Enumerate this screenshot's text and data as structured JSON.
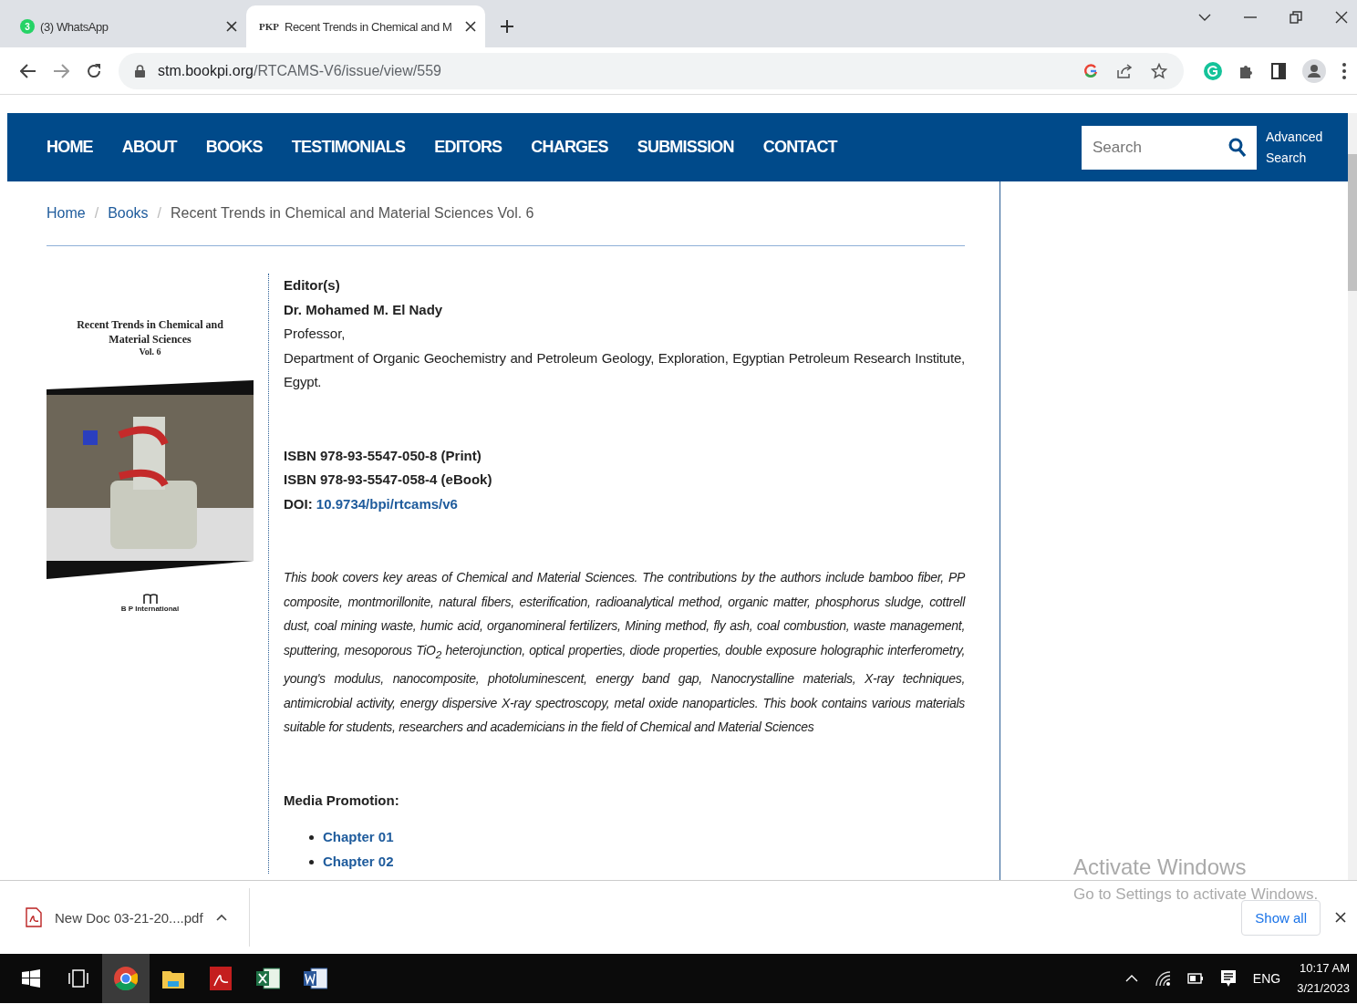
{
  "browser": {
    "tabs": [
      {
        "kind": "whatsapp",
        "badge": "3",
        "title": "(3) WhatsApp",
        "selected": false
      },
      {
        "kind": "pkp",
        "badge": "PKP",
        "title": "Recent Trends in Chemical and M",
        "selected": true
      }
    ],
    "address": {
      "domain": "stm.bookpi.org",
      "path": "/RTCAMS-V6/issue/view/559"
    }
  },
  "nav": {
    "items": [
      "HOME",
      "ABOUT",
      "BOOKS",
      "TESTIMONIALS",
      "EDITORS",
      "CHARGES",
      "SUBMISSION",
      "CONTACT"
    ],
    "search": {
      "placeholder": "Search"
    },
    "advanced_search": [
      "Advanced",
      "Search"
    ]
  },
  "breadcrumb": {
    "links": [
      "Home",
      "Books"
    ],
    "separator": "/",
    "current": "Recent Trends in Chemical and Material Sciences Vol. 6"
  },
  "cover": {
    "title_lines": [
      "Recent Trends in Chemical and",
      "Material Sciences"
    ],
    "volume": "Vol. 6",
    "publisher": "B P International"
  },
  "details": {
    "editors_heading": "Editor(s)",
    "editor_name": "Dr. Mohamed M. El Nady",
    "editor_role": "Professor,",
    "editor_affiliation": "Department of Organic Geochemistry and Petroleum Geology, Exploration, Egyptian Petroleum Research Institute, Egypt.",
    "isbn": [
      "ISBN 978-93-5547-050-8 (Print)",
      "ISBN 978-93-5547-058-4 (eBook)"
    ],
    "doi_label": "DOI:",
    "doi_link": "10.9734/bpi/rtcams/v6",
    "description": "This book covers key areas of Chemical and Material Sciences. The contributions by the authors include bamboo fiber, PP composite, montmorillonite, natural fibers, esterification, radioanalytical method, organic matter, phosphorus sludge, cottrell dust, coal mining waste, humic acid, organomineral fertilizers, Mining method, fly ash, coal combustion, waste management, sputtering, mesoporous TiO$_{2}$ heterojunction, optical properties, diode properties, double exposure holographic interferometry, young's modulus, nanocomposite, photoluminescent, energy band gap, Nanocrystalline materials, X-ray techniques, antimicrobial activity, energy dispersive X-ray spectroscopy, metal oxide nanoparticles. This book contains various materials suitable for students, researchers and academicians in the field of Chemical and Material Sciences",
    "media_heading": "Media Promotion:",
    "media_links": [
      "Chapter 01",
      "Chapter 02"
    ]
  },
  "download_bar": {
    "file": "New Doc 03-21-20....pdf",
    "show_all": "Show all"
  },
  "activation": {
    "title": "Activate Windows",
    "message": "Go to Settings to activate Windows."
  },
  "taskbar": {
    "apps": [
      {
        "kind": "start",
        "selected": false
      },
      {
        "kind": "taskview",
        "selected": false
      },
      {
        "kind": "chrome",
        "selected": true
      },
      {
        "kind": "explorer",
        "selected": false
      },
      {
        "kind": "acrobat",
        "selected": false
      },
      {
        "kind": "excel",
        "selected": false
      },
      {
        "kind": "word",
        "selected": false
      }
    ],
    "language": "ENG",
    "time": "10:17 AM",
    "date": "3/21/2023"
  }
}
